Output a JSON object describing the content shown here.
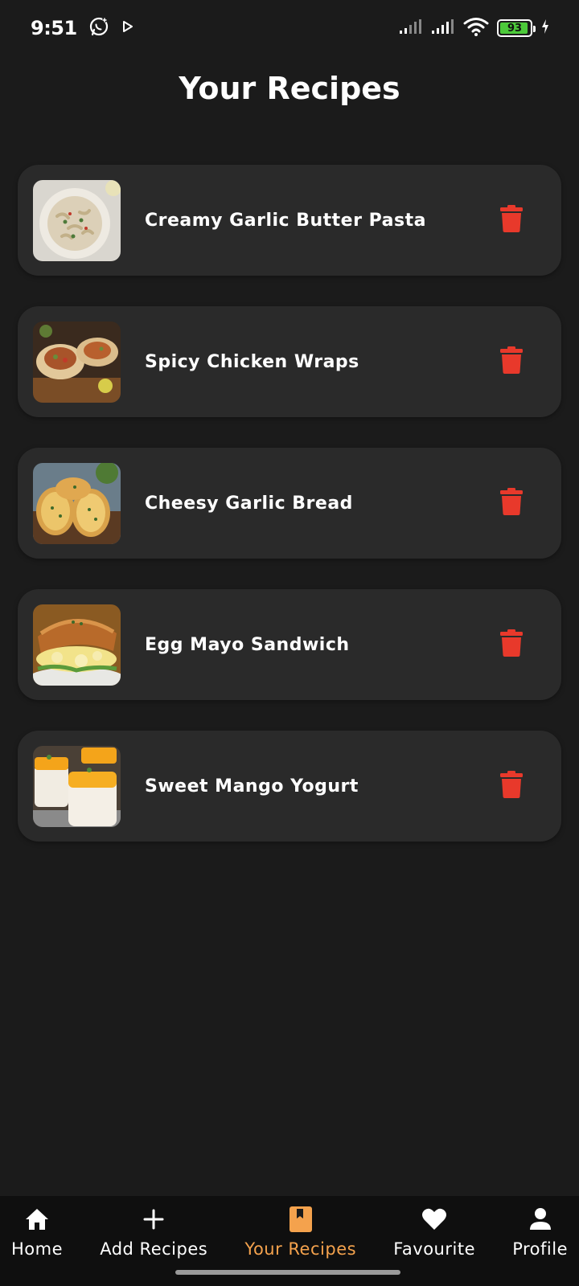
{
  "status_bar": {
    "time": "9:51",
    "battery_level": "93",
    "battery_color": "#4cc93a"
  },
  "page": {
    "title": "Your Recipes"
  },
  "recipes": [
    {
      "name": "Creamy Garlic Butter Pasta",
      "image": "pasta-photo"
    },
    {
      "name": "Spicy Chicken Wraps",
      "image": "chicken-wrap-photo"
    },
    {
      "name": "Cheesy Garlic Bread",
      "image": "garlic-bread-photo"
    },
    {
      "name": "Egg Mayo Sandwich",
      "image": "sandwich-photo"
    },
    {
      "name": "Sweet Mango Yogurt",
      "image": "mango-yogurt-photo"
    }
  ],
  "colors": {
    "background": "#1b1b1b",
    "card": "#2a2a2a",
    "delete": "#e8392b",
    "accent": "#f4a24d",
    "nav_background": "#0f0f0f"
  },
  "bottom_nav": {
    "items": [
      {
        "label": "Home",
        "icon": "home-icon",
        "active": false
      },
      {
        "label": "Add Recipes",
        "icon": "plus-icon",
        "active": false
      },
      {
        "label": "Your Recipes",
        "icon": "bookmark-book-icon",
        "active": true
      },
      {
        "label": "Favourite",
        "icon": "heart-icon",
        "active": false
      },
      {
        "label": "Profile",
        "icon": "person-icon",
        "active": false
      }
    ]
  }
}
